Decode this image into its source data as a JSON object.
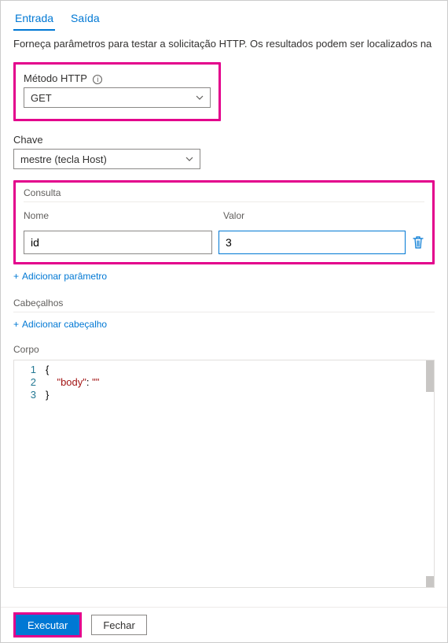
{
  "tabs": {
    "input": "Entrada",
    "output": "Saída"
  },
  "description": "Forneça parâmetros para testar a solicitação HTTP. Os resultados podem ser localizados na guia S",
  "method": {
    "label": "Método HTTP",
    "value": "GET"
  },
  "key": {
    "label": "Chave",
    "value": "mestre (tecla Host)"
  },
  "query": {
    "title": "Consulta",
    "name_label": "Nome",
    "value_label": "Valor",
    "params": [
      {
        "name": "id",
        "value": "3"
      }
    ],
    "add_label": "Adicionar parâmetro"
  },
  "headers": {
    "title": "Cabeçalhos",
    "add_label": "Adicionar cabeçalho"
  },
  "body": {
    "label": "Corpo",
    "code_lines": [
      "{",
      "    \"body\": \"\"",
      "}"
    ]
  },
  "footer": {
    "run": "Executar",
    "close": "Fechar"
  }
}
